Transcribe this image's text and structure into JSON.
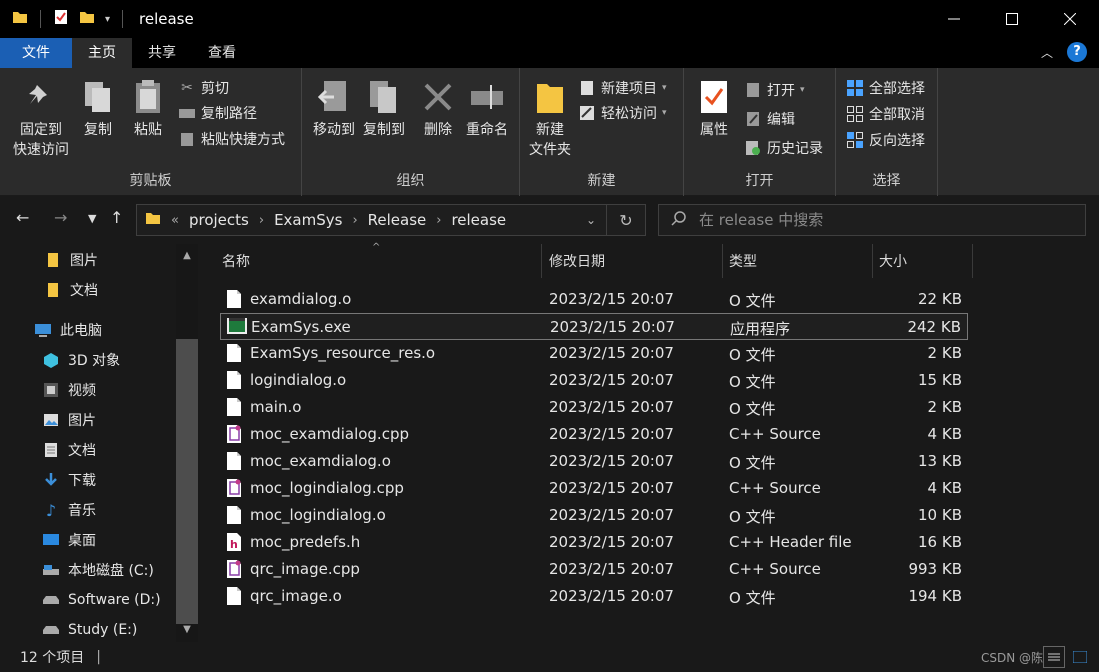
{
  "window": {
    "title": "release",
    "qa_icons": [
      "folder-icon",
      "properties-icon",
      "new-folder-icon",
      "dropdown-icon"
    ]
  },
  "tabs": [
    {
      "label": "文件"
    },
    {
      "label": "主页"
    },
    {
      "label": "共享"
    },
    {
      "label": "查看"
    }
  ],
  "ribbon": {
    "clipboard": {
      "label": "剪贴板",
      "pin_label_1": "固定到",
      "pin_label_2": "快速访问",
      "copy": "复制",
      "paste": "粘贴",
      "cut": "剪切",
      "copy_path": "复制路径",
      "paste_shortcut": "粘贴快捷方式"
    },
    "organize": {
      "label": "组织",
      "move_to": "移动到",
      "copy_to": "复制到",
      "delete": "删除",
      "rename": "重命名"
    },
    "new": {
      "label": "新建",
      "new_folder_1": "新建",
      "new_folder_2": "文件夹",
      "new_item": "新建项目",
      "easy_access": "轻松访问"
    },
    "open": {
      "label": "打开",
      "properties": "属性",
      "open": "打开",
      "edit": "编辑",
      "history": "历史记录"
    },
    "select": {
      "label": "选择",
      "select_all": "全部选择",
      "select_none": "全部取消",
      "invert": "反向选择"
    }
  },
  "address": {
    "overflow": "«",
    "crumbs": [
      "projects",
      "ExamSys",
      "Release",
      "release"
    ]
  },
  "search": {
    "placeholder": "在 release 中搜索"
  },
  "navpane": {
    "items": [
      {
        "label": "图片",
        "icon": "folder-icon"
      },
      {
        "label": "文档",
        "icon": "folder-icon"
      },
      {
        "label": "此电脑",
        "icon": "computer-icon"
      },
      {
        "label": "3D 对象",
        "icon": "3d-objects-icon"
      },
      {
        "label": "视频",
        "icon": "video-icon"
      },
      {
        "label": "图片",
        "icon": "pictures-icon"
      },
      {
        "label": "文档",
        "icon": "documents-icon"
      },
      {
        "label": "下载",
        "icon": "download-icon"
      },
      {
        "label": "音乐",
        "icon": "music-icon"
      },
      {
        "label": "桌面",
        "icon": "desktop-icon"
      },
      {
        "label": "本地磁盘 (C:)",
        "icon": "drive-icon"
      },
      {
        "label": "Software (D:)",
        "icon": "drive-icon"
      },
      {
        "label": "Study (E:)",
        "icon": "drive-icon"
      }
    ]
  },
  "columns": {
    "name": "名称",
    "date": "修改日期",
    "type": "类型",
    "size": "大小"
  },
  "files": [
    {
      "name": "examdialog.o",
      "date": "2023/2/15 20:07",
      "type": "O 文件",
      "size": "22 KB",
      "icon": "file-icon"
    },
    {
      "name": "ExamSys.exe",
      "date": "2023/2/15 20:07",
      "type": "应用程序",
      "size": "242 KB",
      "icon": "exe-icon"
    },
    {
      "name": "ExamSys_resource_res.o",
      "date": "2023/2/15 20:07",
      "type": "O 文件",
      "size": "2 KB",
      "icon": "file-icon"
    },
    {
      "name": "logindialog.o",
      "date": "2023/2/15 20:07",
      "type": "O 文件",
      "size": "15 KB",
      "icon": "file-icon"
    },
    {
      "name": "main.o",
      "date": "2023/2/15 20:07",
      "type": "O 文件",
      "size": "2 KB",
      "icon": "file-icon"
    },
    {
      "name": "moc_examdialog.cpp",
      "date": "2023/2/15 20:07",
      "type": "C++ Source",
      "size": "4 KB",
      "icon": "cpp-file-icon"
    },
    {
      "name": "moc_examdialog.o",
      "date": "2023/2/15 20:07",
      "type": "O 文件",
      "size": "13 KB",
      "icon": "file-icon"
    },
    {
      "name": "moc_logindialog.cpp",
      "date": "2023/2/15 20:07",
      "type": "C++ Source",
      "size": "4 KB",
      "icon": "cpp-file-icon"
    },
    {
      "name": "moc_logindialog.o",
      "date": "2023/2/15 20:07",
      "type": "O 文件",
      "size": "10 KB",
      "icon": "file-icon"
    },
    {
      "name": "moc_predefs.h",
      "date": "2023/2/15 20:07",
      "type": "C++ Header file",
      "size": "16 KB",
      "icon": "header-file-icon"
    },
    {
      "name": "qrc_image.cpp",
      "date": "2023/2/15 20:07",
      "type": "C++ Source",
      "size": "993 KB",
      "icon": "cpp-file-icon"
    },
    {
      "name": "qrc_image.o",
      "date": "2023/2/15 20:07",
      "type": "O 文件",
      "size": "194 KB",
      "icon": "file-icon"
    }
  ],
  "status": {
    "count": "12 个项目",
    "watermark": "CSDN @陈"
  },
  "colors": {
    "file_tab": "#1b5fb4",
    "background": "#191919",
    "ribbon": "#2b2b2b",
    "folder": "#f4c542"
  }
}
